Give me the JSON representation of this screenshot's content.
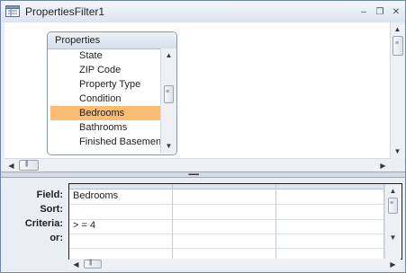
{
  "window": {
    "title": "PropertiesFilter1",
    "controls": {
      "minimize": "–",
      "restore": "❐",
      "close": "✕"
    }
  },
  "field_list": {
    "title": "Properties",
    "items": [
      {
        "label": "State"
      },
      {
        "label": "ZIP Code"
      },
      {
        "label": "Property Type"
      },
      {
        "label": "Condition"
      },
      {
        "label": "Bedrooms",
        "selected": true
      },
      {
        "label": "Bathrooms"
      },
      {
        "label": "Finished Basement"
      }
    ]
  },
  "design_grid": {
    "row_labels": {
      "field": "Field:",
      "sort": "Sort:",
      "criteria": "Criteria:",
      "or": "or:"
    },
    "columns": [
      {
        "field": "Bedrooms",
        "sort": "",
        "criteria": "> = 4",
        "or": ""
      },
      {
        "field": "",
        "sort": "",
        "criteria": "",
        "or": ""
      },
      {
        "field": "",
        "sort": "",
        "criteria": "",
        "or": ""
      }
    ]
  },
  "icons": {
    "scroll_up": "up-arrow-icon",
    "scroll_down": "down-arrow-icon",
    "scroll_left": "left-arrow-icon",
    "scroll_right": "right-arrow-icon",
    "app": "query-window-icon"
  },
  "colors": {
    "selected_item": "#fbbd73",
    "frame": "#6f86a6"
  }
}
